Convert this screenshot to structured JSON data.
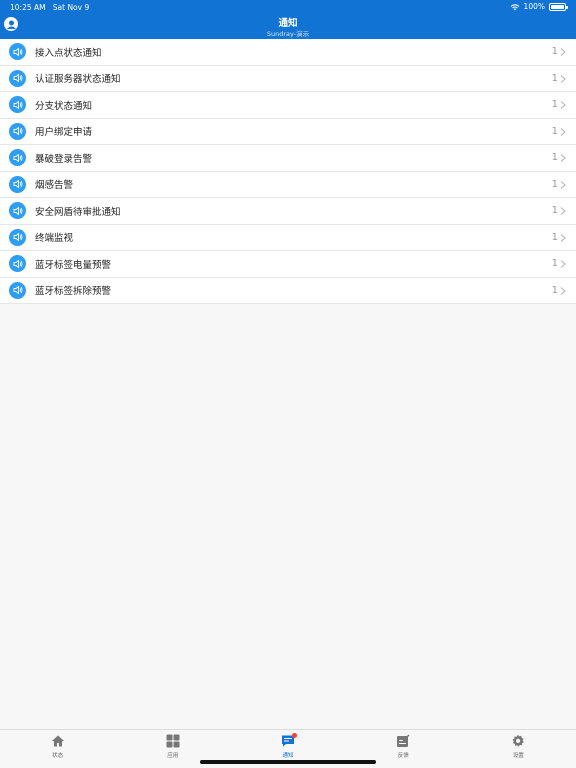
{
  "status_bar": {
    "time": "10:25 AM",
    "date": "Sat Nov 9",
    "battery": "100%"
  },
  "header": {
    "title": "通知",
    "subtitle": "Sundray-演示"
  },
  "notifications": [
    {
      "label": "接入点状态通知",
      "count": "1"
    },
    {
      "label": "认证服务器状态通知",
      "count": "1"
    },
    {
      "label": "分支状态通知",
      "count": "1"
    },
    {
      "label": "用户绑定申请",
      "count": "1"
    },
    {
      "label": "暴破登录告警",
      "count": "1"
    },
    {
      "label": "烟感告警",
      "count": "1"
    },
    {
      "label": "安全网盾待审批通知",
      "count": "1"
    },
    {
      "label": "终端监视",
      "count": "1"
    },
    {
      "label": "蓝牙标签电量预警",
      "count": "1"
    },
    {
      "label": "蓝牙标签拆除预警",
      "count": "1"
    }
  ],
  "tabs": [
    {
      "label": "状态",
      "icon": "home-icon"
    },
    {
      "label": "应用",
      "icon": "grid-icon"
    },
    {
      "label": "通知",
      "icon": "message-icon",
      "active": true
    },
    {
      "label": "反馈",
      "icon": "feedback-icon"
    },
    {
      "label": "设置",
      "icon": "gear-icon"
    }
  ],
  "colors": {
    "accent": "#1173d4",
    "icon_bg": "#2e9df2",
    "badge": "#ff3b30"
  }
}
